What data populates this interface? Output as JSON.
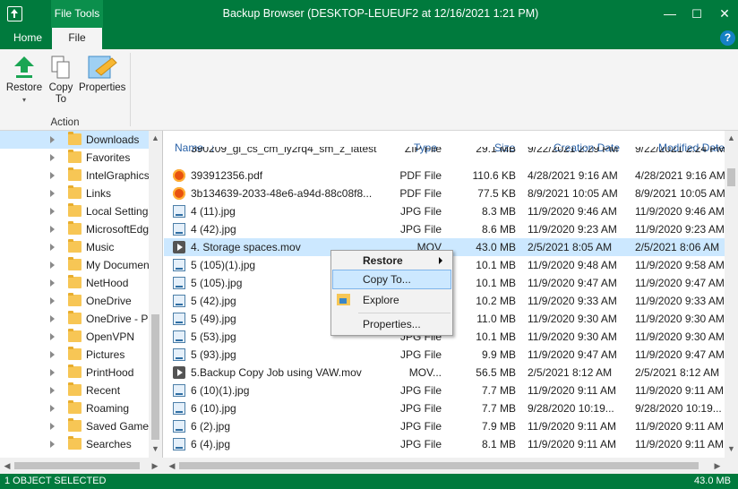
{
  "window": {
    "title": "Backup Browser (DESKTOP-LEUEUF2 at 12/16/2021 1:21 PM)",
    "contextual_tab_label": "File Tools",
    "minimize_glyph": "—",
    "maximize_glyph": "☐",
    "close_glyph": "✕"
  },
  "tabs": {
    "home": "Home",
    "file": "File",
    "help": "?"
  },
  "ribbon": {
    "restore_label": "Restore",
    "restore_dropdown": "▾",
    "copy_to_line1": "Copy",
    "copy_to_line2": "To",
    "properties_label": "Properties",
    "group_label": "Action"
  },
  "tree": {
    "items": [
      {
        "label": "Downloads",
        "selected": true
      },
      {
        "label": "Favorites"
      },
      {
        "label": "IntelGraphics"
      },
      {
        "label": "Links"
      },
      {
        "label": "Local Settings"
      },
      {
        "label": "MicrosoftEdge"
      },
      {
        "label": "Music"
      },
      {
        "label": "My Documents"
      },
      {
        "label": "NetHood"
      },
      {
        "label": "OneDrive"
      },
      {
        "label": "OneDrive - Pr"
      },
      {
        "label": "OpenVPN"
      },
      {
        "label": "Pictures"
      },
      {
        "label": "PrintHood"
      },
      {
        "label": "Recent"
      },
      {
        "label": "Roaming"
      },
      {
        "label": "Saved Games"
      },
      {
        "label": "Searches"
      }
    ]
  },
  "columns": {
    "name": "Name",
    "sort_glyph": "↓",
    "type": "Type",
    "size": "Size",
    "created": "Creation Date",
    "modified": "Modified Date"
  },
  "files": [
    {
      "name": "390209_gi_cs_cm_iy2rq4_sm_z_latest",
      "type": "ZIP File",
      "size": "29.1 MB",
      "created": "9/22/2021 2:29 PM",
      "modified": "9/22/2021 2:24 PM",
      "icon": "zip"
    },
    {
      "name": "393912356.pdf",
      "type": "PDF File",
      "size": "110.6 KB",
      "created": "4/28/2021 9:16 AM",
      "modified": "4/28/2021 9:16 AM",
      "icon": "pdf"
    },
    {
      "name": "3b134639-2033-48e6-a94d-88c08f8...",
      "type": "PDF File",
      "size": "77.5 KB",
      "created": "8/9/2021 10:05 AM",
      "modified": "8/9/2021 10:05 AM",
      "icon": "pdf"
    },
    {
      "name": "4 (11).jpg",
      "type": "JPG File",
      "size": "8.3 MB",
      "created": "11/9/2020 9:46 AM",
      "modified": "11/9/2020 9:46 AM",
      "icon": "jpg"
    },
    {
      "name": "4 (42).jpg",
      "type": "JPG File",
      "size": "8.6 MB",
      "created": "11/9/2020 9:23 AM",
      "modified": "11/9/2020 9:23 AM",
      "icon": "jpg"
    },
    {
      "name": "4. Storage spaces.mov",
      "type": "MOV",
      "size": "43.0 MB",
      "created": "2/5/2021 8:05 AM",
      "modified": "2/5/2021 8:06 AM",
      "icon": "mov",
      "selected": true
    },
    {
      "name": "5 (105)(1).jpg",
      "type": "JPG File",
      "size": "10.1 MB",
      "created": "11/9/2020 9:48 AM",
      "modified": "11/9/2020 9:58 AM",
      "icon": "jpg"
    },
    {
      "name": "5 (105).jpg",
      "type": "JPG File",
      "size": "10.1 MB",
      "created": "11/9/2020 9:47 AM",
      "modified": "11/9/2020 9:47 AM",
      "icon": "jpg"
    },
    {
      "name": "5 (42).jpg",
      "type": "JPG File",
      "size": "10.2 MB",
      "created": "11/9/2020 9:33 AM",
      "modified": "11/9/2020 9:33 AM",
      "icon": "jpg"
    },
    {
      "name": "5 (49).jpg",
      "type": "JPG File",
      "size": "11.0 MB",
      "created": "11/9/2020 9:30 AM",
      "modified": "11/9/2020 9:30 AM",
      "icon": "jpg"
    },
    {
      "name": "5 (53).jpg",
      "type": "JPG File",
      "size": "10.1 MB",
      "created": "11/9/2020 9:30 AM",
      "modified": "11/9/2020 9:30 AM",
      "icon": "jpg"
    },
    {
      "name": "5 (93).jpg",
      "type": "JPG File",
      "size": "9.9 MB",
      "created": "11/9/2020 9:47 AM",
      "modified": "11/9/2020 9:47 AM",
      "icon": "jpg"
    },
    {
      "name": "5.Backup Copy Job using VAW.mov",
      "type": "MOV...",
      "size": "56.5 MB",
      "created": "2/5/2021 8:12 AM",
      "modified": "2/5/2021 8:12 AM",
      "icon": "mov"
    },
    {
      "name": "6 (10)(1).jpg",
      "type": "JPG File",
      "size": "7.7 MB",
      "created": "11/9/2020 9:11 AM",
      "modified": "11/9/2020 9:11 AM",
      "icon": "jpg"
    },
    {
      "name": "6 (10).jpg",
      "type": "JPG File",
      "size": "7.7 MB",
      "created": "9/28/2020 10:19...",
      "modified": "9/28/2020 10:19...",
      "icon": "jpg"
    },
    {
      "name": "6 (2).jpg",
      "type": "JPG File",
      "size": "7.9 MB",
      "created": "11/9/2020 9:11 AM",
      "modified": "11/9/2020 9:11 AM",
      "icon": "jpg"
    },
    {
      "name": "6 (4).jpg",
      "type": "JPG File",
      "size": "8.1 MB",
      "created": "11/9/2020 9:11 AM",
      "modified": "11/9/2020 9:11 AM",
      "icon": "jpg"
    }
  ],
  "context_menu": {
    "restore": "Restore",
    "copy_to": "Copy To...",
    "explore": "Explore",
    "properties": "Properties..."
  },
  "status": {
    "selection": "1 OBJECT SELECTED",
    "size": "43.0 MB"
  },
  "colors": {
    "brand_green": "#007a3d",
    "selection_blue": "#cce8ff",
    "header_blue": "#2b63a8"
  }
}
